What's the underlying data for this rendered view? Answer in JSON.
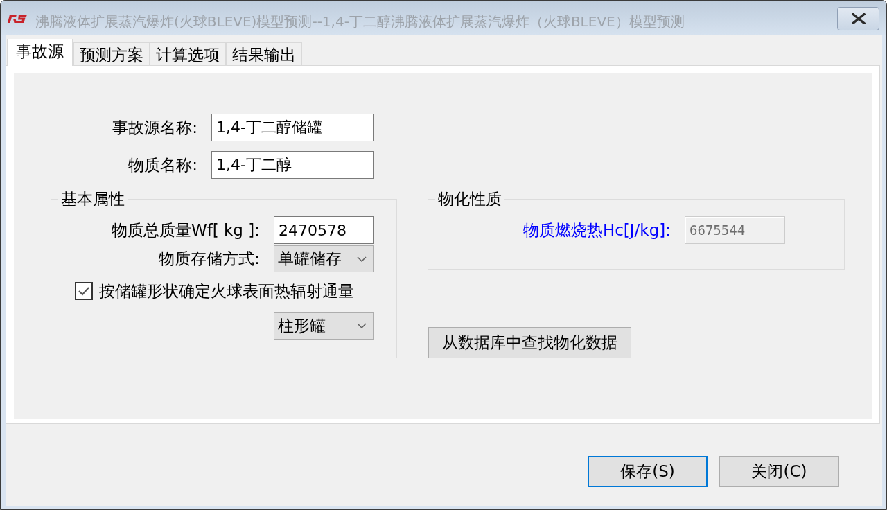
{
  "window": {
    "title": "沸腾液体扩展蒸汽爆炸(火球BLEVE)模型预测--1,4-丁二醇沸腾液体扩展蒸汽爆炸（火球BLEVE）模型预测"
  },
  "tabs": [
    {
      "label": "事故源",
      "selected": true
    },
    {
      "label": "预测方案",
      "selected": false
    },
    {
      "label": "计算选项",
      "selected": false
    },
    {
      "label": "结果输出",
      "selected": false
    }
  ],
  "source_fields": [
    {
      "label": "事故源名称:",
      "value": "1,4-丁二醇储罐"
    },
    {
      "label": "物质名称:",
      "value": "1,4-丁二醇"
    }
  ],
  "basic_properties": {
    "title": "基本属性",
    "rows": [
      {
        "kind": "input",
        "label": "物质总质量Wf[ kg ]:",
        "value": "2470578"
      },
      {
        "kind": "dropdown",
        "label": "物质存储方式:",
        "value": "单罐储存"
      },
      {
        "kind": "checkbox",
        "label": "按储罐形状确定火球表面热辐射通量",
        "checked": true
      },
      {
        "kind": "dropdown",
        "value": "柱形罐"
      }
    ]
  },
  "physical_properties": {
    "title": "物化性质",
    "fields": [
      {
        "label": "物质燃烧热Hc[J/kg]:",
        "value": "6675544",
        "disabled": true,
        "highlighted": true
      }
    ]
  },
  "lookup_button": "从数据库中查找物化数据",
  "buttons": [
    {
      "label": "保存(S)",
      "focused": true
    },
    {
      "label": "关闭(C)",
      "focused": false
    }
  ]
}
